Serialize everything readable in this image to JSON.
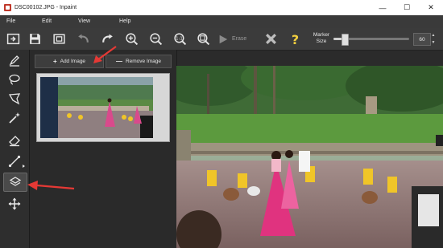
{
  "window": {
    "title": "DSC00102.JPG - Inpaint",
    "controls": {
      "minimize": "—",
      "maximize": "☐",
      "close": "✕"
    }
  },
  "menu": [
    "File",
    "Edit",
    "View",
    "Help"
  ],
  "toolbar": {
    "icons": [
      "open-icon",
      "save-icon",
      "save-as-icon",
      "undo-icon",
      "redo-icon",
      "zoom-in-icon",
      "zoom-out-icon",
      "actual-size-icon",
      "fit-icon",
      "erase-icon",
      "cancel-icon",
      "help-icon"
    ],
    "erase_label": "Erase",
    "marker_label_line1": "Marker",
    "marker_label_line2": "Size",
    "marker_size": "60",
    "marker_fraction": 0.15
  },
  "tools": [
    "marker-tool",
    "lasso-tool",
    "polygonal-lasso-tool",
    "magic-wand-tool",
    "eraser-tool",
    "line-tool",
    "layers-tool",
    "move-tool"
  ],
  "panel": {
    "add_image_label": "Add Image",
    "remove_image_label": "Remove Image"
  },
  "colors": {
    "accent_arrow": "#e53935",
    "toolbar_bg": "#3b3b3b",
    "help_icon": "#f4d03f"
  }
}
